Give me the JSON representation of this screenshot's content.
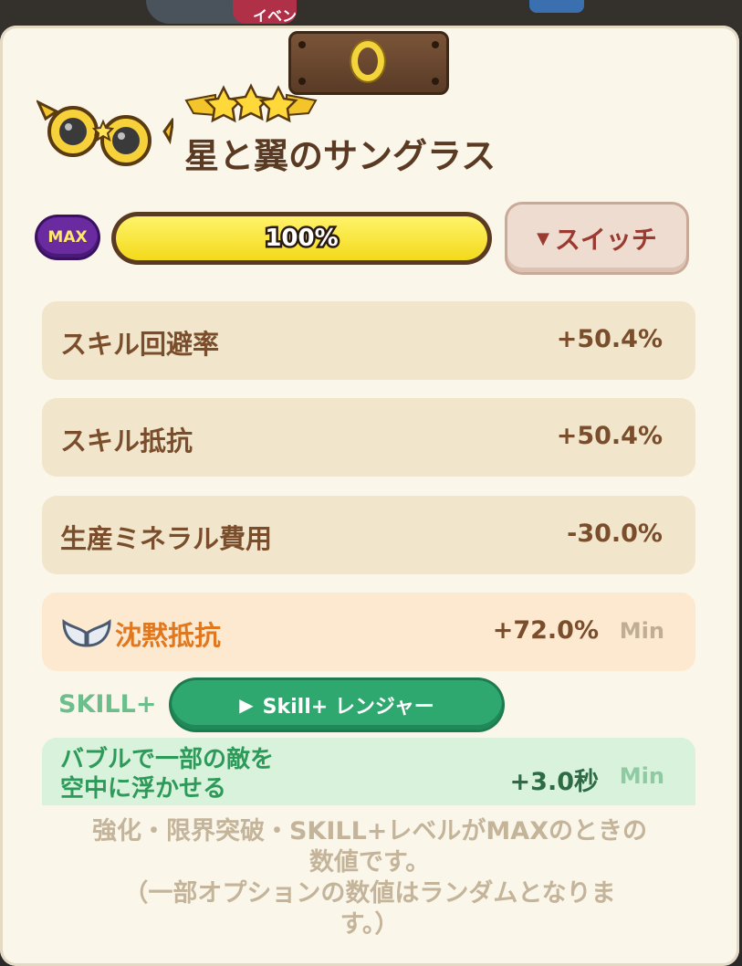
{
  "header": {
    "event_tab_partial": "イベン"
  },
  "item": {
    "name": "星と翼のサングラス",
    "stars": 3,
    "level_badge": "MAX",
    "progress_percent": 100,
    "progress_label": "100%"
  },
  "switch_button": {
    "label": "スイッチ"
  },
  "stats": [
    {
      "label": "スキル回避率",
      "value": "+50.4%"
    },
    {
      "label": "スキル抵抗",
      "value": "+50.4%"
    },
    {
      "label": "生産ミネラル費用",
      "value": "-30.0%"
    }
  ],
  "special_stat": {
    "label": "沈黙抵抗",
    "value": "+72.0%",
    "min_label": "Min"
  },
  "skill": {
    "section_label": "SKILL+",
    "button_label": "Skill+ レンジャー",
    "desc_line1": "バブルで一部の敵を",
    "desc_line2": "空中に浮かせる",
    "value": "+3.0秒",
    "min_label": "Min"
  },
  "note": {
    "line1": "強化・限界突破・SKILL+レベルがMAXのときの",
    "line2": "数値です。",
    "line3": "（一部オプションの数値はランダムとなりま",
    "line4": "す。）"
  },
  "colors": {
    "panel": "#fbf6ea",
    "stat_row": "#f1e6cb",
    "special_row": "#fde9cf",
    "skill_row": "#d8f2dc",
    "accent_green": "#2fa870",
    "progress_fill": "#f3da1a",
    "max_badge": "#6a2aa0"
  }
}
